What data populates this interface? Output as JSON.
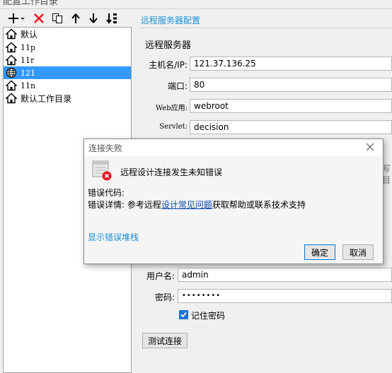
{
  "window": {
    "title_partial": "配置工作目录"
  },
  "toolbar": {
    "items": [
      "add-icon",
      "delete-icon",
      "copy-icon",
      "move-up-icon",
      "move-down-icon",
      "sort-icon"
    ]
  },
  "tree": {
    "items": [
      {
        "label": "默认",
        "icon": "home-icon",
        "selected": false
      },
      {
        "label": "11p",
        "icon": "home-icon",
        "selected": false
      },
      {
        "label": "11r",
        "icon": "home-icon",
        "selected": false
      },
      {
        "label": "121",
        "icon": "globe-icon",
        "selected": true
      },
      {
        "label": "11n",
        "icon": "home-icon",
        "selected": false
      },
      {
        "label": "默认工作目录",
        "icon": "home-icon",
        "selected": false
      }
    ]
  },
  "remote": {
    "section_title": "远程服务器配置",
    "group_title": "远程服务器",
    "host_label": "主机名/IP:",
    "host_value": "121.37.136.25",
    "port_label": "端口:",
    "port_value": "80",
    "webapp_label": "Web应用:",
    "webapp_value": "webroot",
    "servlet_label": "Servlet:",
    "servlet_value": "decision",
    "partial_text_1": "写",
    "partial_text_2": "目",
    "user_label": "用户名:",
    "user_value": "admin",
    "password_label": "密码:",
    "password_value": "••••••••",
    "remember_label": "记住密码",
    "remember_checked": true,
    "test_button": "测试连接"
  },
  "dialog": {
    "title": "连接失败",
    "message": "远程设计连接发生未知错误",
    "error_code_label": "错误代码:",
    "error_detail_prefix": "错误详情: 参考远程",
    "error_detail_link": "设计常见问题",
    "error_detail_suffix": "获取帮助或联系技术支持",
    "show_stack": "显示错误堆栈",
    "ok_button": "确定",
    "cancel_button": "取消"
  },
  "colors": {
    "accent": "#1a8fd6",
    "selection": "#3399ff",
    "error": "#e81123",
    "link": "#0645ad"
  }
}
